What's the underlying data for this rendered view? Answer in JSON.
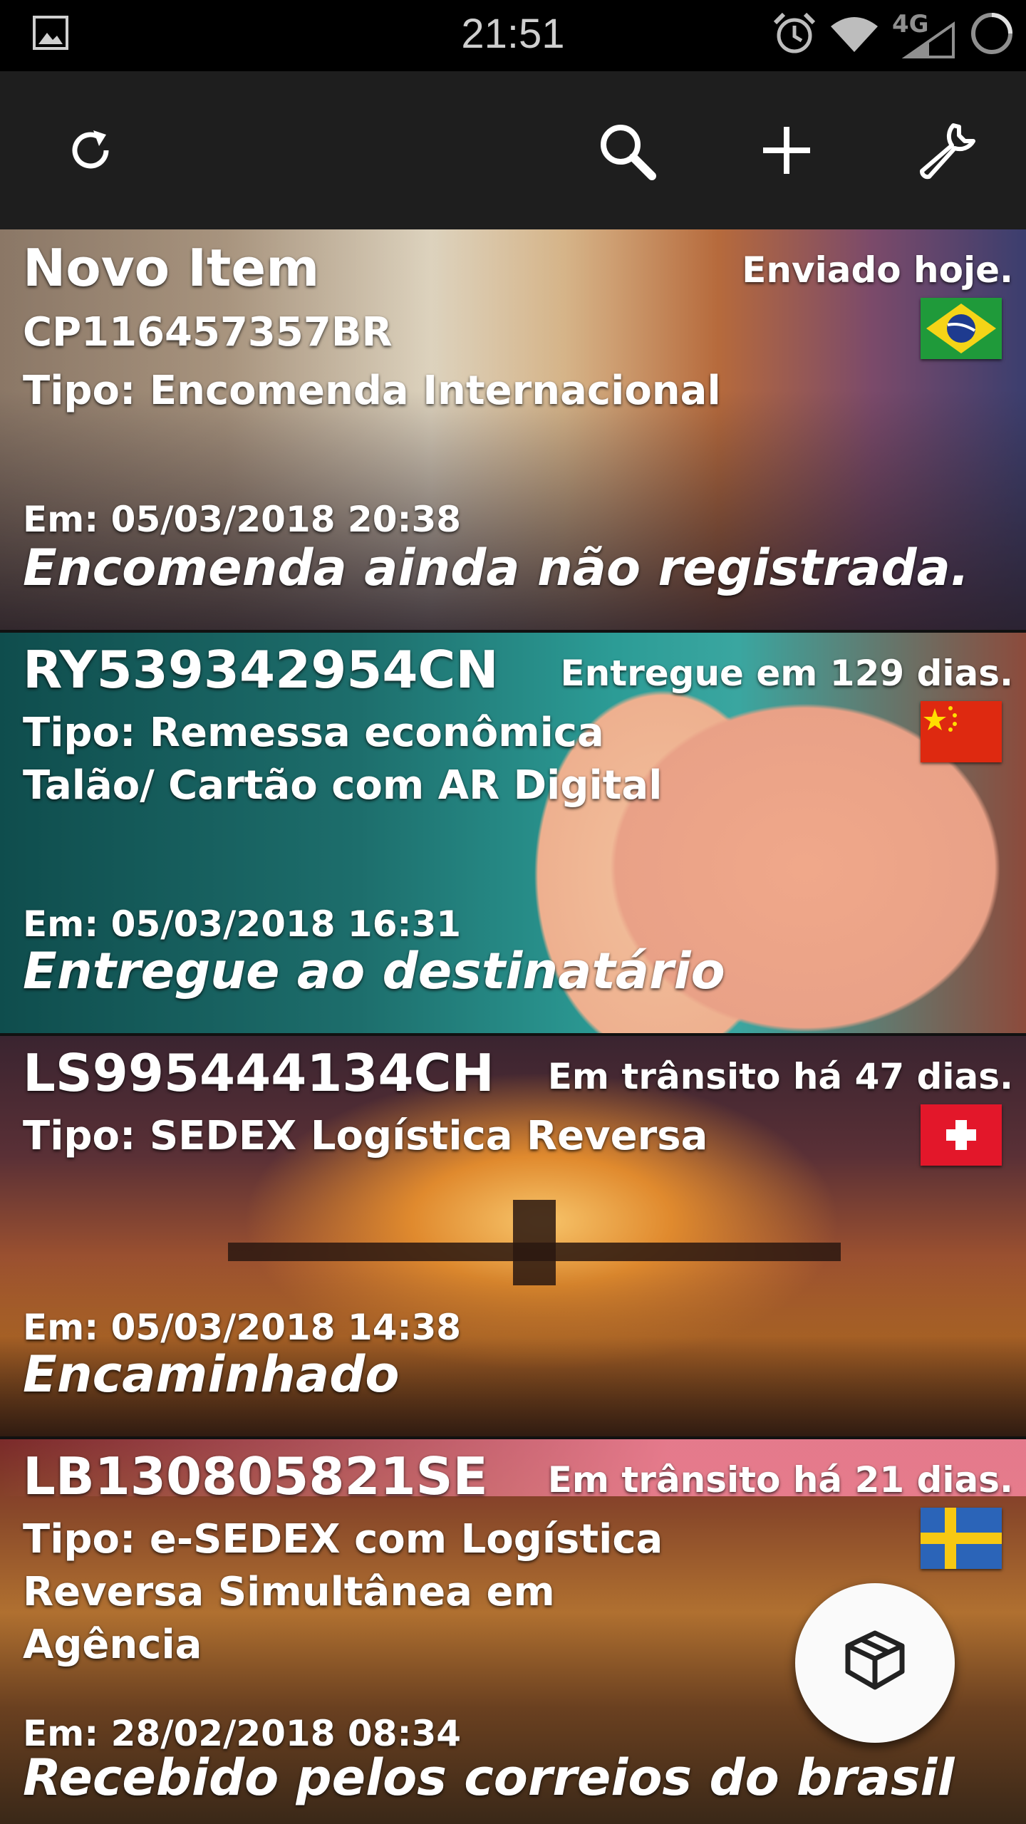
{
  "status_bar": {
    "time": "21:51",
    "network": "4G",
    "icons": [
      "image-icon",
      "alarm-icon",
      "wifi-icon",
      "signal-icon",
      "battery-icon"
    ]
  },
  "toolbar": {
    "icons": [
      "refresh-icon",
      "search-icon",
      "add-icon",
      "wrench-icon"
    ]
  },
  "items": [
    {
      "title": "Novo Item",
      "code": "CP116457357BR",
      "tipo": "Tipo: Encomenda Internacional",
      "status": "Enviado hoje.",
      "country_flag": "brazil-flag-icon",
      "date": "Em: 05/03/2018 20:38",
      "event": "Encomenda ainda não registrada."
    },
    {
      "code": "RY539342954CN",
      "tipo": "Tipo: Remessa econômica Talão/ Cartão com AR Digital",
      "status": "Entregue em 129 dias.",
      "country_flag": "china-flag-icon",
      "date": "Em: 05/03/2018 16:31",
      "event": "Entregue ao destinatário"
    },
    {
      "code": "LS995444134CH",
      "tipo": "Tipo: SEDEX Logística Reversa",
      "status": "Em trânsito há 47 dias.",
      "country_flag": "switzerland-flag-icon",
      "date": "Em: 05/03/2018 14:38",
      "event": "Encaminhado"
    },
    {
      "code": "LB130805821SE",
      "tipo": "Tipo: e-SEDEX com Logística Reversa Simultânea em Agência",
      "status": "Em trânsito há 21 dias.",
      "country_flag": "sweden-flag-icon",
      "date": "Em: 28/02/2018 08:34",
      "event": "Recebido pelos correios do brasil"
    }
  ],
  "fab": {
    "icon": "package-icon"
  },
  "colors": {
    "toolbar": "#1e1e1e",
    "status_bar": "#000000",
    "fab": "#fafafa"
  }
}
